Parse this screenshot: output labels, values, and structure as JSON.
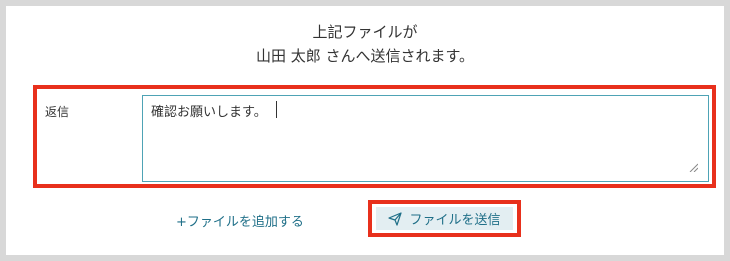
{
  "message": {
    "line1": "上記ファイルが",
    "line2": "山田 太郎 さんへ送信されます。"
  },
  "reply": {
    "label": "返信",
    "value": "確認お願いします。"
  },
  "actions": {
    "add_file_label": "+ファイルを追加する",
    "send_label": "ファイルを送信"
  },
  "colors": {
    "accent": "#1f6f88",
    "highlight": "#e8301c",
    "button_bg": "#e3eef2",
    "textarea_border": "#4ea3b5"
  },
  "icons": {
    "send": "paper-plane-icon",
    "resize": "resize-grip-icon"
  }
}
